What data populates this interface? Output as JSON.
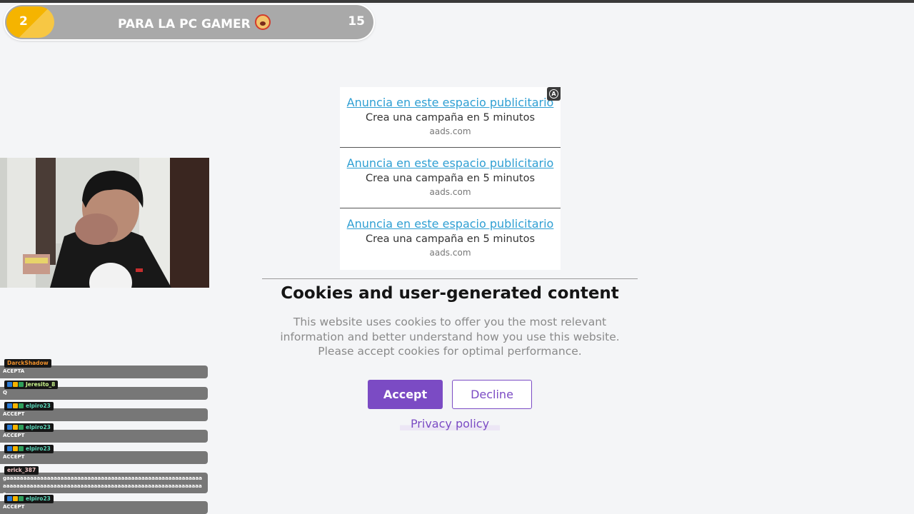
{
  "goal": {
    "current": "2",
    "title": "PARA LA PC GAMER",
    "target": "15",
    "progress_percent": 13
  },
  "ads": {
    "items": [
      {
        "link": "Anuncia en este espacio publicitario",
        "desc": "Crea una campaña en 5 minutos",
        "domain": "aads.com"
      },
      {
        "link": "Anuncia en este espacio publicitario",
        "desc": "Crea una campaña en 5 minutos",
        "domain": "aads.com"
      },
      {
        "link": "Anuncia en este espacio publicitario",
        "desc": "Crea una campaña en 5 minutos",
        "domain": "aads.com"
      }
    ],
    "badge_icon": "aads-logo-icon"
  },
  "cookie": {
    "title": "Cookies and user-generated content",
    "text": "This website uses cookies to offer you the most relevant information and better understand how you use this website. Please accept cookies for optimal performance.",
    "accept_label": "Accept",
    "decline_label": "Decline",
    "privacy_label": "Privacy policy"
  },
  "chat": {
    "messages": [
      {
        "user": "DarckShadow",
        "color": "#f0902a",
        "badges": false,
        "text": "ACEPTA"
      },
      {
        "user": "Jeresito_8",
        "color": "#c7f28a",
        "badges": true,
        "text": "Q"
      },
      {
        "user": "elpiro23",
        "color": "#59d6b8",
        "badges": true,
        "text": "ACCEPT"
      },
      {
        "user": "elpiro23",
        "color": "#59d6b8",
        "badges": true,
        "text": "ACCEPT"
      },
      {
        "user": "elpiro23",
        "color": "#59d6b8",
        "badges": true,
        "text": "ACCEPT"
      },
      {
        "user": "erick_387",
        "color": "#f2c6c6",
        "badges": false,
        "text": "gaaaaaaaaaaaaaaaaaaaaaaaaaaaaaaaaaaaaaaaaaaaaaaaaaaaaaaaaaaaaaaaaaaaaaaaaaaaaaaaaaaaaaaaaaaaaaaaaaaaaaaaaaaaaaaaaaaaaaa"
      },
      {
        "user": "elpiro23",
        "color": "#59d6b8",
        "badges": true,
        "text": "ACCEPT"
      }
    ]
  },
  "colors": {
    "accent": "#7b4bc4",
    "goal_fill": "#f5b400",
    "ad_link": "#2f9fd3"
  }
}
